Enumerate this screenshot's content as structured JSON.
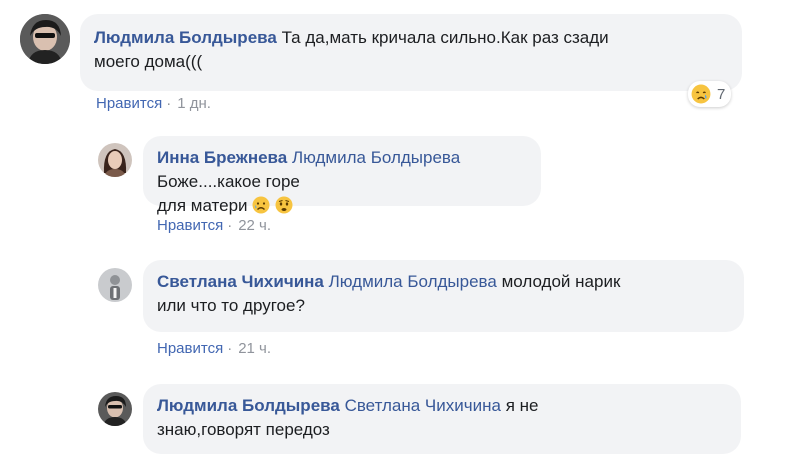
{
  "comments": [
    {
      "author": "Людмила Болдырева",
      "mention": "",
      "text_line1": "Та да,мать кричала сильно.Как раз сзади",
      "text_line2": "моего дома(((",
      "like": "Нравится",
      "time": "1 дн.",
      "reaction_count": "7",
      "reaction_icon": "sad-crying-face-icon"
    },
    {
      "author": "Инна Брежнева",
      "mention": "Людмила Болдырева",
      "text_line1": "Боже....какое горе",
      "text_line2": "для матери",
      "emoji": [
        "sad-face-icon",
        "worried-face-icon"
      ],
      "like": "Нравится",
      "time": "22 ч."
    },
    {
      "author": "Светлана Чихичина",
      "mention": "Людмила Болдырева",
      "text_line1": "молодой нарик",
      "text_line2": "или что то другое?",
      "like": "Нравится",
      "time": "21 ч."
    },
    {
      "author": "Людмила Болдырева",
      "mention": "Светлана Чихичина",
      "text_line1": "я не",
      "text_line2": "знаю,говорят передоз"
    }
  ],
  "colors": {
    "link": "#385898",
    "like": "#4267b2",
    "meta": "#90949c",
    "bubble": "#f2f3f5"
  }
}
